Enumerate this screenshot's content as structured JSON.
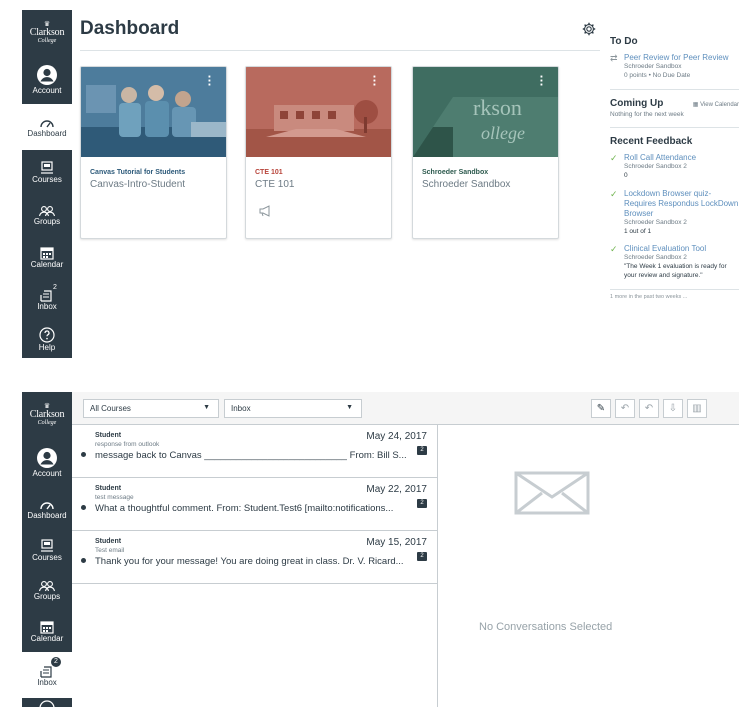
{
  "brand": {
    "crest": "♛",
    "line1": "Clarkson",
    "line2": "College"
  },
  "nav1": [
    {
      "label": "Account"
    },
    {
      "label": "Dashboard"
    },
    {
      "label": "Courses"
    },
    {
      "label": "Groups"
    },
    {
      "label": "Calendar"
    },
    {
      "label": "Inbox",
      "badge": "2"
    },
    {
      "label": "Help"
    }
  ],
  "nav2": [
    {
      "label": "Account"
    },
    {
      "label": "Dashboard"
    },
    {
      "label": "Courses"
    },
    {
      "label": "Groups"
    },
    {
      "label": "Calendar"
    },
    {
      "label": "Inbox",
      "badge": "2"
    }
  ],
  "dashboard": {
    "title": "Dashboard",
    "cards": [
      {
        "title": "Canvas Tutorial for Students",
        "subtitle": "Canvas-Intro-Student",
        "title_color": "#2d5a7a",
        "hero_color": "#3c6b8b"
      },
      {
        "title": "CTE 101",
        "subtitle": "CTE 101",
        "title_color": "#b8443a",
        "hero_color": "#b15a4e"
      },
      {
        "title": "Schroeder Sandbox",
        "subtitle": "Schroeder Sandbox",
        "title_color": "#2d5a4e",
        "hero_color": "#3d6a5e"
      }
    ]
  },
  "todo": {
    "heading": "To Do",
    "item": {
      "title": "Peer Review for Peer Review",
      "course": "Schroeder Sandbox",
      "meta": "0 points • No Due Date"
    },
    "coming_up": {
      "heading": "Coming Up",
      "view_calendar": "View Calendar",
      "empty": "Nothing for the next week"
    },
    "recent_feedback": {
      "heading": "Recent Feedback",
      "items": [
        {
          "title": "Roll Call Attendance",
          "course": "Schroeder Sandbox 2",
          "detail": "0"
        },
        {
          "title": "Lockdown Browser quiz-Requires Respondus LockDown Browser",
          "course": "Schroeder Sandbox 2",
          "detail": "1 out of 1"
        },
        {
          "title": "Clinical Evaluation Tool",
          "course": "Schroeder Sandbox 2",
          "detail": "\"The Week 1 evaluation is ready for your review and signature.\""
        }
      ],
      "more": "1 more in the past two weeks ..."
    }
  },
  "inbox": {
    "course_filter": "All Courses",
    "folder_filter": "Inbox",
    "messages": [
      {
        "from": "Student",
        "date": "May 24, 2017",
        "subject": "response from outlook",
        "preview": "message back to Canvas ___________________________ From: Bill S...",
        "count": "2"
      },
      {
        "from": "Student",
        "date": "May 22, 2017",
        "subject": "test message",
        "preview": "What a thoughtful comment. From: Student.Test6 [mailto:notifications...",
        "count": "2"
      },
      {
        "from": "Student",
        "date": "May 15, 2017",
        "subject": "Test email",
        "preview": "Thank you for your message! You are doing great in class. Dr. V. Ricard...",
        "count": "2"
      }
    ],
    "empty_state": "No Conversations Selected"
  }
}
